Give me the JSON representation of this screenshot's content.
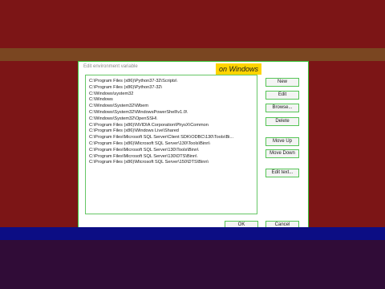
{
  "dialog": {
    "title": "Edit environment variable"
  },
  "caption": "on Windows",
  "paths": [
    "C:\\Program Files (x86)\\Python37-32\\Scripts\\",
    "C:\\Program Files (x86)\\Python37-32\\",
    "C:\\Windows\\system32",
    "C:\\Windows",
    "C:\\Windows\\System32\\Wbem",
    "C:\\Windows\\System32\\WindowsPowerShell\\v1.0\\",
    "C:\\Windows\\System32\\OpenSSH\\",
    "C:\\Program Files (x86)\\NVIDIA Corporation\\PhysX\\Common",
    "C:\\Program Files (x86)\\Windows Live\\Shared",
    "C:\\Program Files\\Microsoft SQL Server\\Client SDK\\ODBC\\130\\Tools\\Bi...",
    "C:\\Program Files (x86)\\Microsoft SQL Server\\130\\Tools\\Binn\\",
    "C:\\Program Files\\Microsoft SQL Server\\130\\Tools\\Binn\\",
    "C:\\Program Files\\Microsoft SQL Server\\130\\DTS\\Binn\\",
    "C:\\Program Files (x86)\\Microsoft SQL Server\\150\\DTS\\Binn\\"
  ],
  "buttons": {
    "new": "New",
    "edit": "Edit",
    "browse": "Browse...",
    "delete": "Delete",
    "move_up": "Move Up",
    "move_down": "Move Down",
    "edit_text": "Edit text...",
    "ok": "OK",
    "cancel": "Cancel"
  },
  "colors": {
    "top_band": "#7c1516",
    "brown_band": "#7a4621",
    "blue_band": "#0c0d84",
    "bottom_band": "#300c37",
    "highlight": "#ffd400",
    "focus_border": "#55c455"
  }
}
